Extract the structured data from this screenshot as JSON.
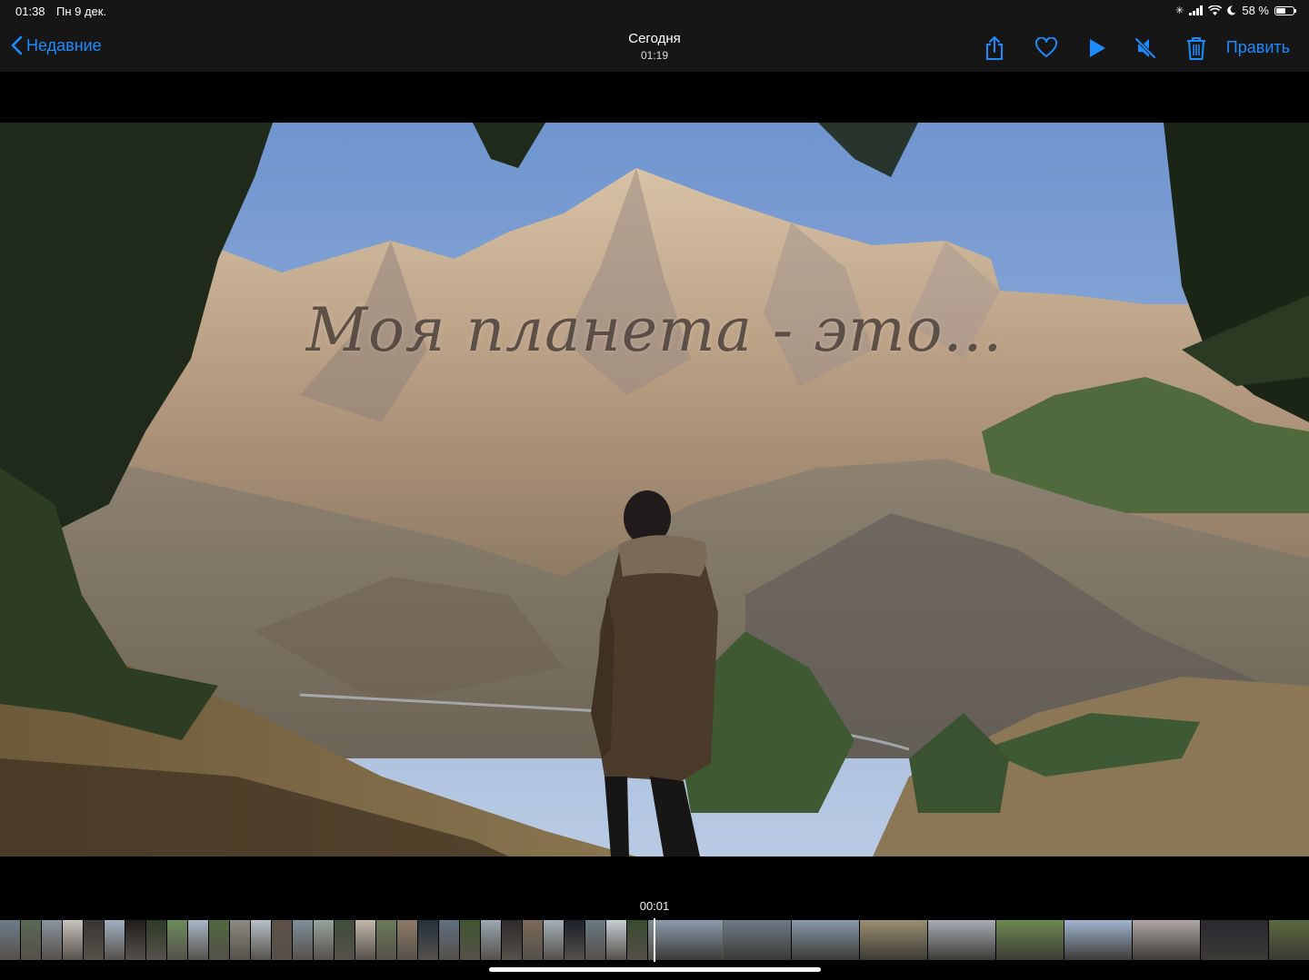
{
  "status": {
    "time": "01:38",
    "date": "Пн 9 дек.",
    "battery": "58 %",
    "battery_level": 0.58
  },
  "nav": {
    "back_label": "Недавние",
    "title": "Сегодня",
    "subtitle": "01:19",
    "edit_label": "Править",
    "icons": [
      "share-icon",
      "heart-icon",
      "play-icon",
      "mute-icon",
      "trash-icon"
    ]
  },
  "video": {
    "overlay_text": "Моя планета - это..."
  },
  "scrubber": {
    "timecode": "00:01"
  },
  "colors": {
    "accent": "#1a8cff",
    "bar": "#161616"
  }
}
